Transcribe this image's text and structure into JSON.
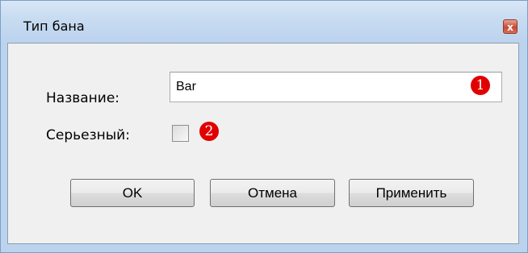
{
  "window": {
    "title": "Тип бана",
    "close_glyph": "x"
  },
  "form": {
    "name_label": "Название:",
    "name_value": "Bar",
    "serious_label": "Серьезный:",
    "serious_checked": false
  },
  "markers": [
    "1",
    "2"
  ],
  "buttons": {
    "ok": "OK",
    "cancel": "Отмена",
    "apply": "Применить"
  },
  "colors": {
    "title_gradient_top": "#d9e7f7",
    "client_background": "#f0f0f0",
    "marker": "#e00000"
  }
}
